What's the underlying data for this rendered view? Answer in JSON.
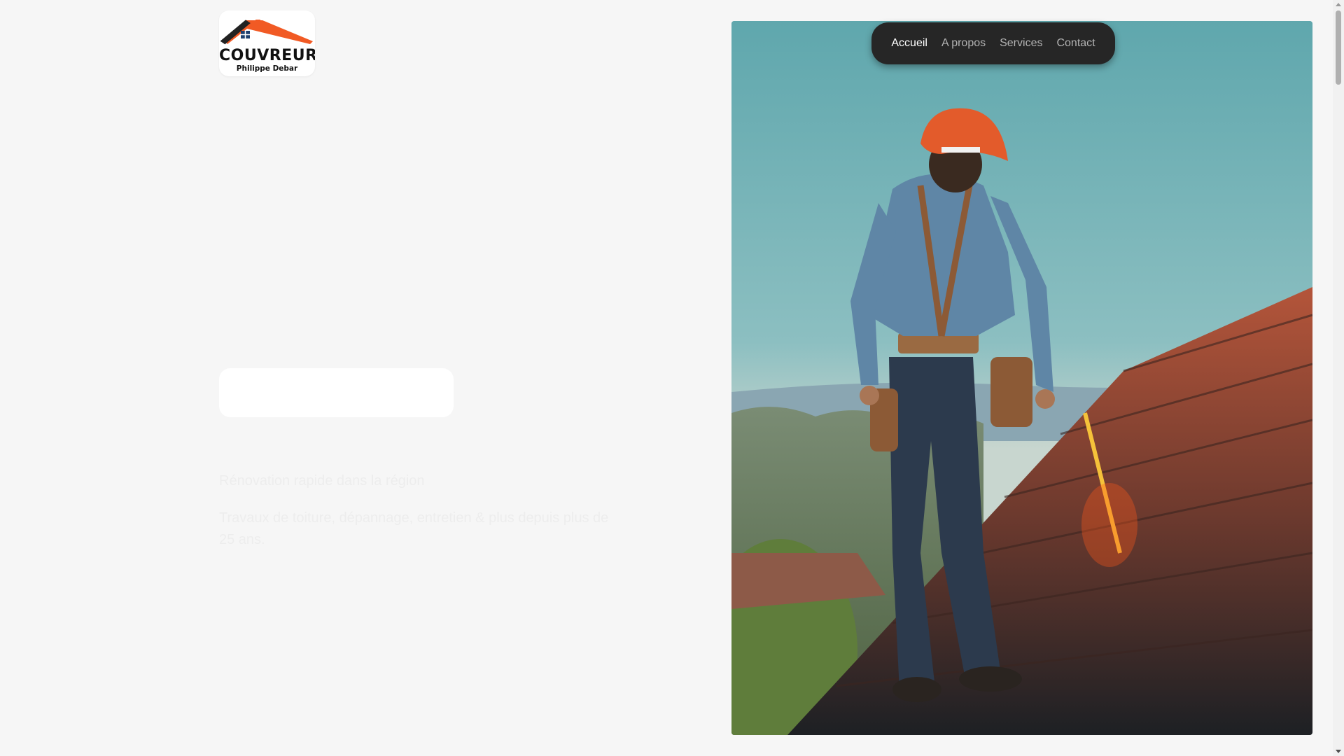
{
  "logo": {
    "title": "COUVREUR",
    "subtitle": "Philippe Debar",
    "icon": "house-roof-icon",
    "colors": {
      "roof": "#f15a24",
      "text": "#111111"
    }
  },
  "nav": {
    "items": [
      {
        "label": "Accueil",
        "active": true
      },
      {
        "label": "A propos",
        "active": false
      },
      {
        "label": "Services",
        "active": false
      },
      {
        "label": "Contact",
        "active": false
      }
    ]
  },
  "hero": {
    "tagline": "Rénovation rapide dans la région",
    "description": "Travaux de toiture, dépannage, entretien & plus depuis plus de 25 ans.",
    "image": "roofer-walking-on-tile-roof-photo"
  },
  "colors": {
    "background": "#f6f6f6",
    "nav_background": "#262626",
    "nav_active": "#ffffff",
    "nav_inactive": "#b3b3b3"
  }
}
